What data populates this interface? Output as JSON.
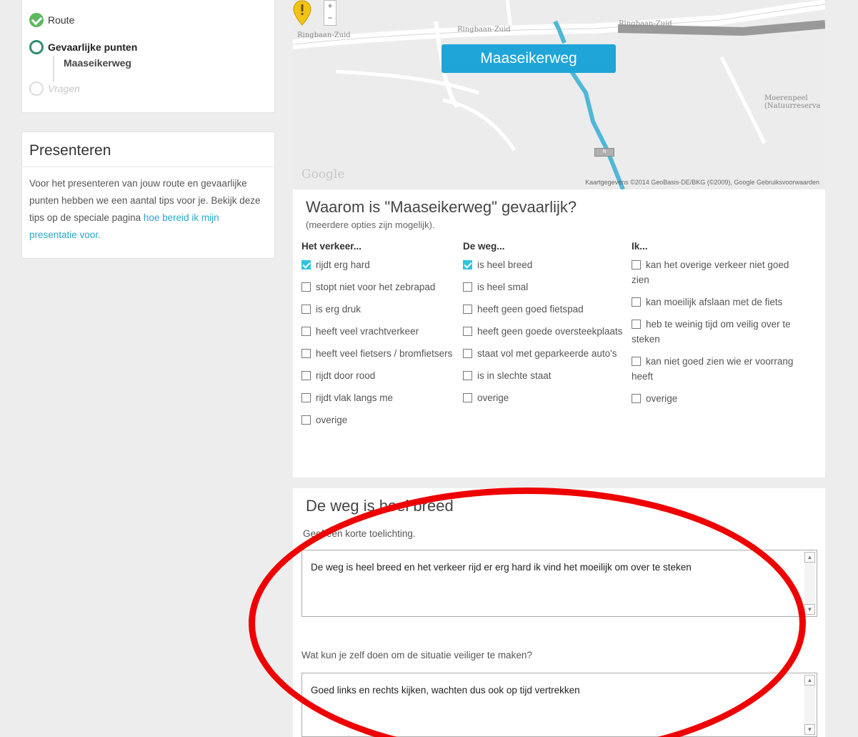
{
  "steps": {
    "route": "Route",
    "gevaarlijke_punten": "Gevaarlijke punten",
    "current_point": "Maaseikerweg",
    "vragen": "Vragen"
  },
  "presenteren": {
    "title": "Presenteren",
    "text": "Voor het presenteren van jouw route en gevaarlijke punten hebben we een aantal tips voor je. Bekijk deze tips op de speciale pagina ",
    "link": "hoe bereid ik mijn presentatie voor."
  },
  "map": {
    "zoom_in": "+",
    "zoom_out": "−",
    "labels": {
      "ringbaan_zuid_left": "Ringbaan-Zuid",
      "ringbaan_zuid_mid": "Ringbaan-Zuid",
      "ringbaan_zuid_right": "Ringbaan-Zuid",
      "natuur": "Moerenpeel (Natuurreserva"
    },
    "callout": "Maaseikerweg",
    "google": "Google",
    "attribution": "Kaartgegevens ©2014 GeoBasis-DE/BKG (©2009), Google   Gebruiksvoorwaarden",
    "colors": {
      "route": "#4fb7d8",
      "callout": "#1fa5d8",
      "pin": "#f3c314"
    }
  },
  "question": {
    "title": "Waarom is \"Maaseikerweg\" gevaarlijk?",
    "subtitle": "(meerdere opties zijn mogelijk).",
    "columns": [
      {
        "heading": "Het verkeer...",
        "options": [
          {
            "label": "rijdt erg hard",
            "checked": true
          },
          {
            "label": "stopt niet voor het zebrapad",
            "checked": false
          },
          {
            "label": "is erg druk",
            "checked": false
          },
          {
            "label": "heeft veel vrachtverkeer",
            "checked": false
          },
          {
            "label": "heeft veel fietsers / bromfietsers",
            "checked": false
          },
          {
            "label": "rijdt door rood",
            "checked": false
          },
          {
            "label": "rijdt vlak langs me",
            "checked": false
          },
          {
            "label": "overige",
            "checked": false
          }
        ]
      },
      {
        "heading": "De weg...",
        "options": [
          {
            "label": "is heel breed",
            "checked": true
          },
          {
            "label": "is heel smal",
            "checked": false
          },
          {
            "label": "heeft geen goed fietspad",
            "checked": false
          },
          {
            "label": "heeft geen goede oversteekplaats",
            "checked": false
          },
          {
            "label": "staat vol met geparkeerde auto's",
            "checked": false
          },
          {
            "label": "is in slechte staat",
            "checked": false
          },
          {
            "label": "overige",
            "checked": false
          }
        ]
      },
      {
        "heading": "Ik...",
        "options": [
          {
            "label": "kan het overige verkeer niet goed zien",
            "checked": false
          },
          {
            "label": "kan moeilijk afslaan met de fiets",
            "checked": false
          },
          {
            "label": "heb te weinig tijd om veilig over te steken",
            "checked": false
          },
          {
            "label": "kan niet goed zien wie er voorrang heeft",
            "checked": false
          },
          {
            "label": "overige",
            "checked": false
          }
        ]
      }
    ]
  },
  "explanation": {
    "title": "De weg is heel breed",
    "label1": "Geef een korte toelichting.",
    "value1": "De weg is heel breed en het verkeer rijd er erg hard ik vind het moeilijk om over te steken",
    "label2": "Wat kun je zelf doen om de situatie veiliger te maken?",
    "value2": "Goed links en rechts kijken, wachten dus ook op tijd vertrekken"
  },
  "annotation_color": "#e00000"
}
